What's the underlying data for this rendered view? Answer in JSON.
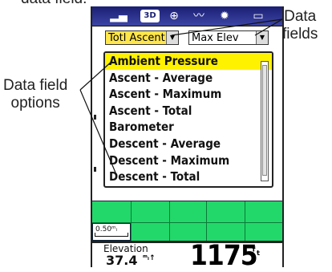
{
  "captions": {
    "top": "data field.",
    "data_fields": "Data\nfields",
    "data_field_options": "Data field\noptions"
  },
  "status_bar": {
    "three_d_badge": "3D"
  },
  "fields": {
    "field1_value": "Totl Ascent",
    "field2_value": "Max Elev"
  },
  "dropdown": {
    "options": [
      "Ambient Pressure",
      "Ascent - Average",
      "Ascent - Maximum",
      "Ascent - Total",
      "Barometer",
      "Descent - Average",
      "Descent - Maximum",
      "Descent - Total"
    ],
    "selected_index": 0
  },
  "map": {
    "scale_label": "0.50ᵐᵢ"
  },
  "bottom": {
    "elevation_label": "Elevation",
    "elevation_small_value": "37.4",
    "elevation_small_unit": "ᵐᵢ↑",
    "elevation_big_value": "1175",
    "elevation_big_unit": "ᶠₜ"
  },
  "colors": {
    "status_bar": "#1a1f73",
    "selected_option": "#fff200",
    "field_highlight": "#ffe64a",
    "map_grid": "#22d86a"
  }
}
